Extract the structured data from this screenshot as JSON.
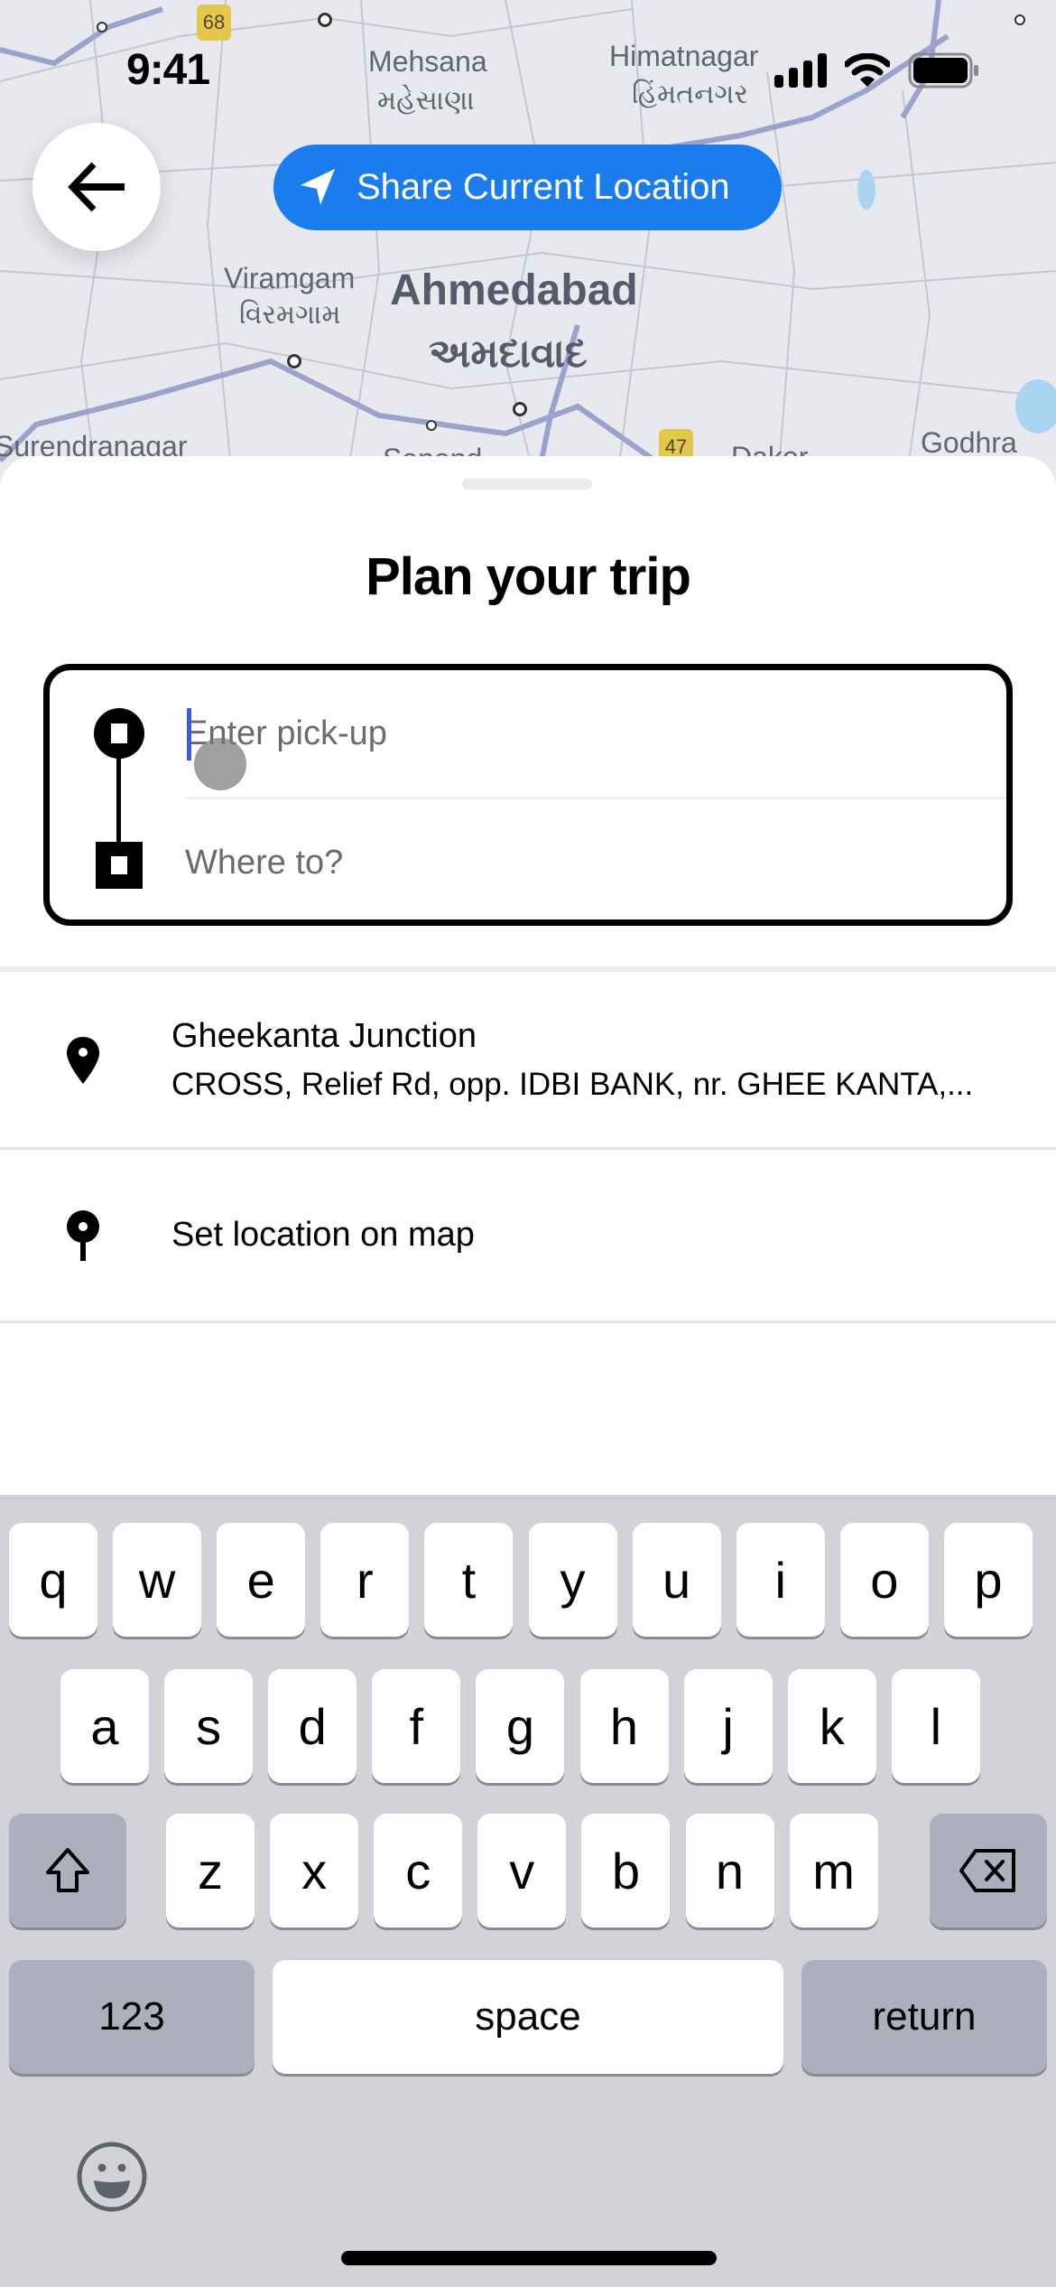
{
  "status_bar": {
    "time": "9:41"
  },
  "map": {
    "labels": [
      {
        "id": "mehsana",
        "text": "Mehsana"
      },
      {
        "id": "mehsana_gu",
        "text": "મહેસાણા"
      },
      {
        "id": "himatnagar",
        "text": "Himatnagar"
      },
      {
        "id": "himatnagar_gu",
        "text": "હિંમતનગર"
      },
      {
        "id": "viramgam",
        "text": "Viramgam"
      },
      {
        "id": "viramgam_gu",
        "text": "વિરમગામ"
      },
      {
        "id": "ahmedabad",
        "text": "Ahmedabad"
      },
      {
        "id": "ahmedabad_gu",
        "text": "અમદાવાદ"
      },
      {
        "id": "surendranagar",
        "text": "Surendranagar"
      },
      {
        "id": "sanand",
        "text": "Sanand"
      },
      {
        "id": "dakor",
        "text": "Dakor"
      },
      {
        "id": "godhra",
        "text": "Godhra"
      }
    ],
    "shields": [
      "68",
      "47"
    ]
  },
  "share_location": {
    "label": "Share Current Location",
    "color": "#1a7ced"
  },
  "sheet": {
    "title": "Plan your trip",
    "pickup": {
      "value": "",
      "placeholder": "Enter pick-up"
    },
    "destination": {
      "value": "",
      "placeholder": "Where to?"
    },
    "suggestions": [
      {
        "title": "Gheekanta Junction",
        "subtitle": "CROSS, Relief Rd, opp. IDBI BANK, nr. GHEE KANTA,..."
      },
      {
        "title": "Set location on map"
      }
    ]
  },
  "keyboard": {
    "row1": [
      "q",
      "w",
      "e",
      "r",
      "t",
      "y",
      "u",
      "i",
      "o",
      "p"
    ],
    "row2": [
      "a",
      "s",
      "d",
      "f",
      "g",
      "h",
      "j",
      "k",
      "l"
    ],
    "row3": [
      "z",
      "x",
      "c",
      "v",
      "b",
      "n",
      "m"
    ],
    "numbers_label": "123",
    "space_label": "space",
    "return_label": "return"
  }
}
